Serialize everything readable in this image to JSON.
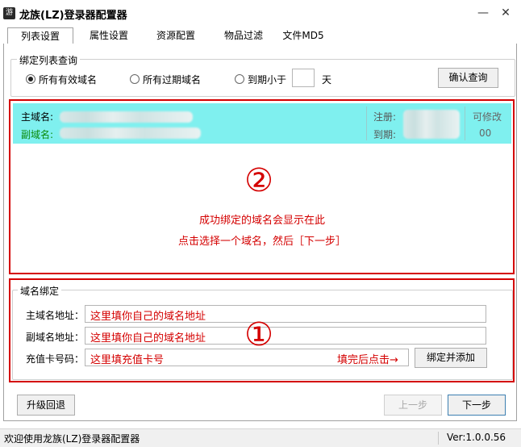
{
  "window": {
    "title": "龙族(LZ)登录器配置器",
    "icon_glyph": "游",
    "minimize_glyph": "—",
    "close_glyph": "✕"
  },
  "tabs": [
    {
      "label": "列表设置",
      "active": true
    },
    {
      "label": "属性设置"
    },
    {
      "label": "资源配置"
    },
    {
      "label": "物品过滤"
    },
    {
      "label": "文件MD5"
    }
  ],
  "query": {
    "legend": "绑定列表查询",
    "radio_all_valid": "所有有效域名",
    "radio_all_expired": "所有过期域名",
    "radio_expire_lt": "到期小于",
    "days_unit": "天",
    "days_value": "",
    "confirm_button": "确认查询"
  },
  "list": {
    "row": {
      "primary_label": "主域名:",
      "secondary_label": "副域名:",
      "register_label": "注册:",
      "expire_label": "到期:",
      "editable_label": "可修改",
      "editable_value": "00"
    },
    "circle_number": "②",
    "hint_line1": "成功绑定的域名会显示在此",
    "hint_line2": "点击选择一个域名，然后［下一步］"
  },
  "bind": {
    "legend": "域名绑定",
    "primary_label": "主域名地址：",
    "primary_value": "这里填你自己的域名地址",
    "secondary_label": "副域名地址：",
    "secondary_value": "这里填你自己的域名地址",
    "card_label": "充值卡号码：",
    "card_value": "这里填充值卡号",
    "circle_number": "①",
    "after_fill_hint": "填完后点击→",
    "bind_button": "绑定并添加"
  },
  "footer": {
    "upgrade_button": "升级回退",
    "prev_button": "上一步",
    "next_button": "下一步"
  },
  "status": {
    "welcome": "欢迎使用龙族(LZ)登录器配置器",
    "version": "Ver:1.0.0.56"
  },
  "colors": {
    "annotation_red": "#d40000",
    "selected_row": "#7ff0ef"
  }
}
